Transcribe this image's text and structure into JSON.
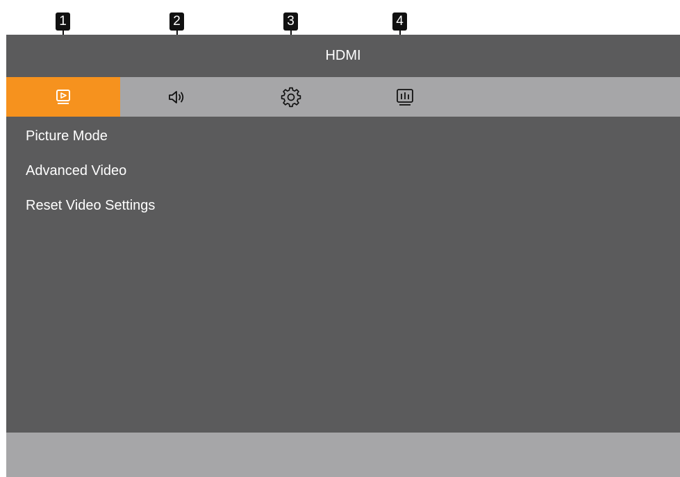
{
  "title_bar": {
    "label": "HDMI"
  },
  "tabs": [
    {
      "icon": "picture-icon",
      "active": true
    },
    {
      "icon": "speaker-icon",
      "active": false
    },
    {
      "icon": "gear-icon",
      "active": false
    },
    {
      "icon": "display-info-icon",
      "active": false
    }
  ],
  "menu": {
    "items": [
      {
        "label": "Picture Mode"
      },
      {
        "label": "Advanced Video"
      },
      {
        "label": "Reset Video Settings"
      }
    ]
  },
  "callouts": [
    "1",
    "2",
    "3",
    "4"
  ],
  "colors": {
    "active_tab": "#f6921e",
    "panel": "#5b5b5c",
    "tab_bar": "#a6a6a8",
    "callout": "#111111"
  }
}
